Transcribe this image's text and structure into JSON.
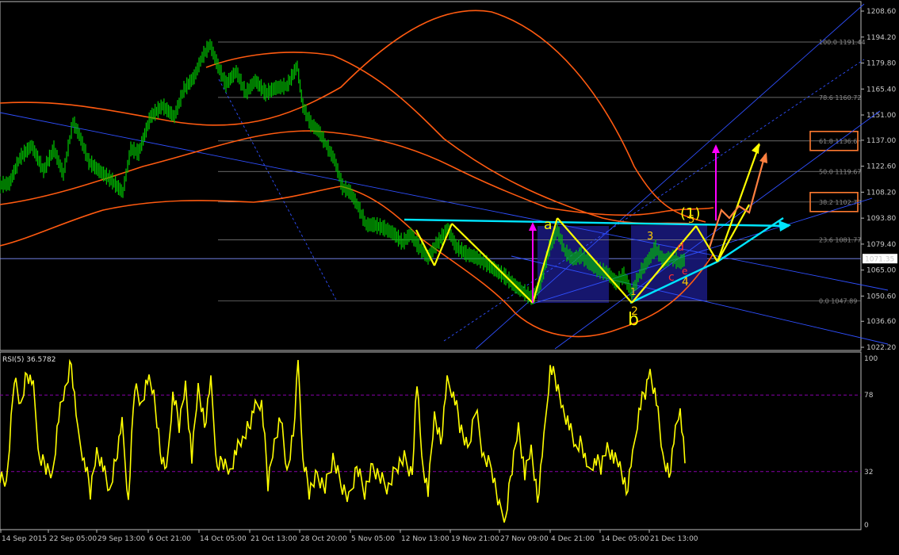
{
  "chart_data": {
    "type": "line",
    "price_panel": {
      "y_ticks": [
        "1208.60",
        "1194.20",
        "1179.80",
        "1165.40",
        "1151.00",
        "1137.00",
        "1122.60",
        "1108.20",
        "1093.80",
        "1079.40",
        "1065.00",
        "1050.60",
        "1036.60",
        "1022.20"
      ],
      "current_price": "1071.35",
      "ylim": [
        1022.2,
        1208.6
      ],
      "price_series": [
        {
          "x": 0,
          "y": 1112
        },
        {
          "x": 12,
          "y": 1113
        },
        {
          "x": 25,
          "y": 1127
        },
        {
          "x": 40,
          "y": 1134
        },
        {
          "x": 55,
          "y": 1120
        },
        {
          "x": 68,
          "y": 1132
        },
        {
          "x": 80,
          "y": 1118
        },
        {
          "x": 92,
          "y": 1147
        },
        {
          "x": 100,
          "y": 1140
        },
        {
          "x": 112,
          "y": 1125
        },
        {
          "x": 125,
          "y": 1120
        },
        {
          "x": 140,
          "y": 1115
        },
        {
          "x": 155,
          "y": 1108
        },
        {
          "x": 165,
          "y": 1132
        },
        {
          "x": 175,
          "y": 1130
        },
        {
          "x": 190,
          "y": 1150
        },
        {
          "x": 205,
          "y": 1156
        },
        {
          "x": 220,
          "y": 1150
        },
        {
          "x": 232,
          "y": 1165
        },
        {
          "x": 245,
          "y": 1172
        },
        {
          "x": 255,
          "y": 1183
        },
        {
          "x": 265,
          "y": 1190
        },
        {
          "x": 275,
          "y": 1178
        },
        {
          "x": 285,
          "y": 1168
        },
        {
          "x": 298,
          "y": 1175
        },
        {
          "x": 310,
          "y": 1163
        },
        {
          "x": 322,
          "y": 1170
        },
        {
          "x": 335,
          "y": 1163
        },
        {
          "x": 348,
          "y": 1166
        },
        {
          "x": 362,
          "y": 1167
        },
        {
          "x": 375,
          "y": 1178
        },
        {
          "x": 382,
          "y": 1156
        },
        {
          "x": 392,
          "y": 1146
        },
        {
          "x": 402,
          "y": 1142
        },
        {
          "x": 412,
          "y": 1134
        },
        {
          "x": 422,
          "y": 1126
        },
        {
          "x": 432,
          "y": 1111
        },
        {
          "x": 442,
          "y": 1108
        },
        {
          "x": 452,
          "y": 1100
        },
        {
          "x": 462,
          "y": 1090
        },
        {
          "x": 472,
          "y": 1090
        },
        {
          "x": 485,
          "y": 1088
        },
        {
          "x": 497,
          "y": 1085
        },
        {
          "x": 508,
          "y": 1080
        },
        {
          "x": 518,
          "y": 1085
        },
        {
          "x": 528,
          "y": 1078
        },
        {
          "x": 540,
          "y": 1072
        },
        {
          "x": 552,
          "y": 1080
        },
        {
          "x": 565,
          "y": 1088
        },
        {
          "x": 575,
          "y": 1078
        },
        {
          "x": 588,
          "y": 1074
        },
        {
          "x": 600,
          "y": 1072
        },
        {
          "x": 612,
          "y": 1069
        },
        {
          "x": 625,
          "y": 1065
        },
        {
          "x": 638,
          "y": 1061
        },
        {
          "x": 650,
          "y": 1056
        },
        {
          "x": 660,
          "y": 1053
        },
        {
          "x": 672,
          "y": 1049
        },
        {
          "x": 682,
          "y": 1058
        },
        {
          "x": 693,
          "y": 1077
        },
        {
          "x": 703,
          "y": 1087
        },
        {
          "x": 713,
          "y": 1075
        },
        {
          "x": 723,
          "y": 1071
        },
        {
          "x": 733,
          "y": 1073
        },
        {
          "x": 743,
          "y": 1069
        },
        {
          "x": 755,
          "y": 1065
        },
        {
          "x": 767,
          "y": 1063
        },
        {
          "x": 777,
          "y": 1058
        },
        {
          "x": 787,
          "y": 1062
        },
        {
          "x": 797,
          "y": 1052
        },
        {
          "x": 807,
          "y": 1063
        },
        {
          "x": 817,
          "y": 1070
        },
        {
          "x": 827,
          "y": 1077
        },
        {
          "x": 837,
          "y": 1070
        },
        {
          "x": 847,
          "y": 1072
        },
        {
          "x": 857,
          "y": 1069
        },
        {
          "x": 865,
          "y": 1071
        }
      ]
    },
    "fib_levels": [
      {
        "ratio": "100.0",
        "price": "1191.44",
        "label": "100.0 1191.44",
        "boxed": false
      },
      {
        "ratio": "78.6",
        "price": "1160.72",
        "label": "78.6 1160.72",
        "boxed": false
      },
      {
        "ratio": "61.8",
        "price": "1136.6",
        "label": "61.8 1136.6",
        "boxed": true
      },
      {
        "ratio": "50.0",
        "price": "1119.67",
        "label": "50.0 1119.67",
        "boxed": false
      },
      {
        "ratio": "38.2",
        "price": "1102.73",
        "label": "38.2 1102.73",
        "boxed": true
      },
      {
        "ratio": "23.6",
        "price": "1081.77",
        "label": "23.6 1081.77",
        "boxed": false
      },
      {
        "ratio": "0.0",
        "price": "1047.89",
        "label": "0.0 1047.89",
        "boxed": false
      }
    ],
    "annotations": [
      {
        "text": "a",
        "color": "#ffff00"
      },
      {
        "text": "b",
        "color": "#ffff00"
      },
      {
        "text": "(1)",
        "color": "#ffff00"
      },
      {
        "text": "3",
        "color": "#ffcc00"
      },
      {
        "text": "1",
        "color": "#ffcc00"
      },
      {
        "text": "2",
        "color": "#ffcc00"
      },
      {
        "text": "4",
        "color": "#ffcc00"
      },
      {
        "text": "5",
        "color": "#ffcc00"
      },
      {
        "text": "c",
        "color": "#ff3030"
      },
      {
        "text": "d",
        "color": "#ff3030"
      },
      {
        "text": "e",
        "color": "#ff3030"
      }
    ],
    "rsi_panel": {
      "title": "RSI(5) 36.5782",
      "y_ticks": [
        "100",
        "78",
        "32",
        "0"
      ],
      "levels": [
        78,
        32
      ],
      "ylim": [
        0,
        100
      ],
      "values": [
        {
          "x": 0,
          "y": 30
        },
        {
          "x": 8,
          "y": 25
        },
        {
          "x": 18,
          "y": 88
        },
        {
          "x": 26,
          "y": 70
        },
        {
          "x": 34,
          "y": 92
        },
        {
          "x": 42,
          "y": 82
        },
        {
          "x": 50,
          "y": 40
        },
        {
          "x": 58,
          "y": 35
        },
        {
          "x": 66,
          "y": 30
        },
        {
          "x": 74,
          "y": 65
        },
        {
          "x": 82,
          "y": 80
        },
        {
          "x": 90,
          "y": 98
        },
        {
          "x": 98,
          "y": 55
        },
        {
          "x": 106,
          "y": 40
        },
        {
          "x": 114,
          "y": 20
        },
        {
          "x": 122,
          "y": 45
        },
        {
          "x": 130,
          "y": 35
        },
        {
          "x": 138,
          "y": 18
        },
        {
          "x": 146,
          "y": 40
        },
        {
          "x": 154,
          "y": 60
        },
        {
          "x": 162,
          "y": 15
        },
        {
          "x": 170,
          "y": 85
        },
        {
          "x": 178,
          "y": 72
        },
        {
          "x": 186,
          "y": 88
        },
        {
          "x": 194,
          "y": 78
        },
        {
          "x": 202,
          "y": 45
        },
        {
          "x": 210,
          "y": 30
        },
        {
          "x": 218,
          "y": 80
        },
        {
          "x": 226,
          "y": 60
        },
        {
          "x": 234,
          "y": 85
        },
        {
          "x": 242,
          "y": 40
        },
        {
          "x": 250,
          "y": 82
        },
        {
          "x": 258,
          "y": 60
        },
        {
          "x": 266,
          "y": 85
        },
        {
          "x": 274,
          "y": 35
        },
        {
          "x": 282,
          "y": 38
        },
        {
          "x": 290,
          "y": 32
        },
        {
          "x": 298,
          "y": 45
        },
        {
          "x": 306,
          "y": 50
        },
        {
          "x": 314,
          "y": 60
        },
        {
          "x": 322,
          "y": 70
        },
        {
          "x": 330,
          "y": 75
        },
        {
          "x": 338,
          "y": 25
        },
        {
          "x": 346,
          "y": 50
        },
        {
          "x": 354,
          "y": 65
        },
        {
          "x": 362,
          "y": 30
        },
        {
          "x": 370,
          "y": 55
        },
        {
          "x": 376,
          "y": 98
        },
        {
          "x": 382,
          "y": 40
        },
        {
          "x": 390,
          "y": 20
        },
        {
          "x": 400,
          "y": 30
        },
        {
          "x": 410,
          "y": 22
        },
        {
          "x": 420,
          "y": 40
        },
        {
          "x": 430,
          "y": 25
        },
        {
          "x": 440,
          "y": 15
        },
        {
          "x": 450,
          "y": 35
        },
        {
          "x": 460,
          "y": 20
        },
        {
          "x": 470,
          "y": 35
        },
        {
          "x": 480,
          "y": 28
        },
        {
          "x": 490,
          "y": 22
        },
        {
          "x": 500,
          "y": 35
        },
        {
          "x": 510,
          "y": 40
        },
        {
          "x": 520,
          "y": 30
        },
        {
          "x": 526,
          "y": 88
        },
        {
          "x": 532,
          "y": 40
        },
        {
          "x": 540,
          "y": 20
        },
        {
          "x": 548,
          "y": 65
        },
        {
          "x": 556,
          "y": 50
        },
        {
          "x": 564,
          "y": 85
        },
        {
          "x": 572,
          "y": 80
        },
        {
          "x": 580,
          "y": 60
        },
        {
          "x": 590,
          "y": 45
        },
        {
          "x": 600,
          "y": 70
        },
        {
          "x": 610,
          "y": 40
        },
        {
          "x": 620,
          "y": 35
        },
        {
          "x": 630,
          "y": 10
        },
        {
          "x": 638,
          "y": 5
        },
        {
          "x": 646,
          "y": 35
        },
        {
          "x": 654,
          "y": 60
        },
        {
          "x": 662,
          "y": 30
        },
        {
          "x": 670,
          "y": 45
        },
        {
          "x": 678,
          "y": 15
        },
        {
          "x": 686,
          "y": 50
        },
        {
          "x": 694,
          "y": 96
        },
        {
          "x": 702,
          "y": 85
        },
        {
          "x": 710,
          "y": 70
        },
        {
          "x": 718,
          "y": 60
        },
        {
          "x": 726,
          "y": 45
        },
        {
          "x": 734,
          "y": 50
        },
        {
          "x": 742,
          "y": 30
        },
        {
          "x": 750,
          "y": 40
        },
        {
          "x": 758,
          "y": 35
        },
        {
          "x": 766,
          "y": 48
        },
        {
          "x": 774,
          "y": 40
        },
        {
          "x": 782,
          "y": 35
        },
        {
          "x": 790,
          "y": 20
        },
        {
          "x": 798,
          "y": 40
        },
        {
          "x": 806,
          "y": 70
        },
        {
          "x": 814,
          "y": 80
        },
        {
          "x": 820,
          "y": 92
        },
        {
          "x": 828,
          "y": 75
        },
        {
          "x": 836,
          "y": 40
        },
        {
          "x": 844,
          "y": 30
        },
        {
          "x": 852,
          "y": 55
        },
        {
          "x": 858,
          "y": 70
        },
        {
          "x": 864,
          "y": 37
        }
      ]
    },
    "x_ticks": [
      "14 Sep 2015",
      "22 Sep 05:00",
      "29 Sep 13:00",
      "6 Oct 21:00",
      "14 Oct 05:00",
      "21 Oct 13:00",
      "28 Oct 20:00",
      "5 Nov 05:00",
      "12 Nov 13:00",
      "19 Nov 21:00",
      "27 Nov 09:00",
      "4 Dec 21:00",
      "14 Dec 05:00",
      "21 Dec 13:00"
    ],
    "grid": false,
    "title": "",
    "xlabel": "",
    "ylabel": "",
    "colors": {
      "background": "#000000",
      "bars": "#00c800",
      "envelope": "#ff5a10",
      "fib": "#8a8a8a",
      "channel": "#2f4fff",
      "wave_arrows": "#ffff00",
      "trendline": "#00e5ff",
      "magenta_arrow": "#ff00ff",
      "orange_arrow": "#ff8040",
      "rsi": "#ffff00",
      "rsi_level": "#8800aa",
      "box_fill": "#1a1a80",
      "fib_label_box": "#ff7a30"
    }
  }
}
